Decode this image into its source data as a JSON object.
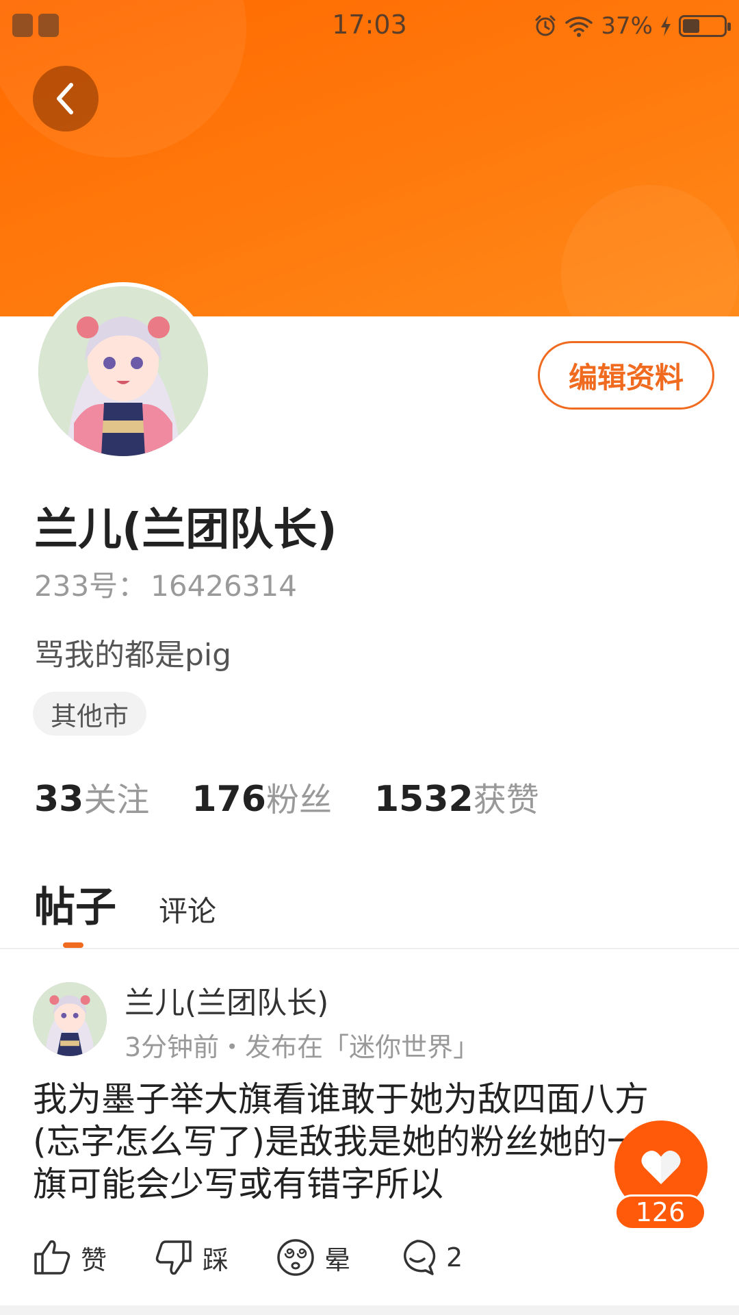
{
  "status_bar": {
    "time": "17:03",
    "battery_percent": "37%",
    "battery_level": 0.37,
    "icons": [
      "alarm-icon",
      "wifi-icon",
      "charging-icon",
      "battery-icon"
    ]
  },
  "header": {
    "back_icon": "chevron-left-icon"
  },
  "profile": {
    "edit_label": "编辑资料",
    "username": "兰儿(兰团队长)",
    "id_label": "233号：",
    "id_value": "16426314",
    "bio": "骂我的都是pig",
    "location": "其他市",
    "stats": {
      "following_count": "33",
      "following_label": "关注",
      "followers_count": "176",
      "followers_label": "粉丝",
      "likes_count": "1532",
      "likes_label": "获赞"
    }
  },
  "tabs": {
    "posts": "帖子",
    "comments": "评论",
    "active": "帖子"
  },
  "post": {
    "author": "兰儿(兰团队长)",
    "meta": "3分钟前・发布在「迷你世界」",
    "body": "我为墨子举大旗看谁敢于她为敌四面八方(忘字怎么写了)是敌我是她的粉丝她的一面旗可能会少写或有错字所以",
    "actions": {
      "like": "赞",
      "dislike": "踩",
      "dizzy": "晕",
      "comment_count": "2"
    }
  },
  "floating_like": {
    "count": "126"
  },
  "colors": {
    "brand_orange": "#ff6a00",
    "accent": "#f06b1f"
  }
}
